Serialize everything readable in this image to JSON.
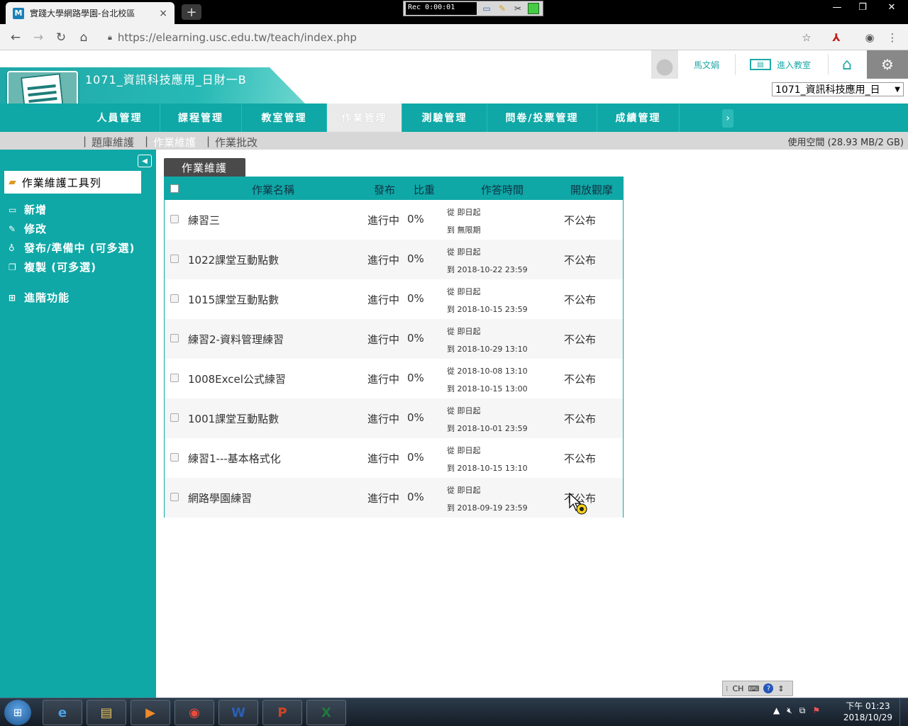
{
  "browser": {
    "tab_title": "實踐大學網路學園-台北校區",
    "tab_favicon": "M",
    "tab_close": "×",
    "new_tab": "+",
    "url": "https://elearning.usc.edu.tw/teach/index.php",
    "recorder_time": "Rec 0:00:01",
    "window_controls": [
      "—",
      "❐",
      "✕"
    ]
  },
  "header": {
    "course_title": "1071_資訊科技應用_日財一B",
    "user_name": "馬文娟",
    "enter_classroom": "進入教室",
    "course_select_value": "1071_資訊科技應用_日"
  },
  "main_nav": [
    {
      "label": "人員管理",
      "active": false
    },
    {
      "label": "課程管理",
      "active": false
    },
    {
      "label": "教室管理",
      "active": false
    },
    {
      "label": "作業管理",
      "active": true
    },
    {
      "label": "測驗管理",
      "active": false
    },
    {
      "label": "問卷/投票管理",
      "active": false
    },
    {
      "label": "成績管理",
      "active": false
    }
  ],
  "sub_nav": {
    "items": [
      {
        "label": "題庫維護",
        "active": false
      },
      {
        "label": "作業維護",
        "active": true
      },
      {
        "label": "作業批改",
        "active": false
      }
    ],
    "separator": "|",
    "usage": "使用空間 (28.93 MB/2 GB)"
  },
  "sidebar": {
    "toolbox_title": "作業維護工具列",
    "items": [
      {
        "label": "新增",
        "icon": "folder-icon"
      },
      {
        "label": "修改",
        "icon": "pencil-icon"
      },
      {
        "label": "發布/準備中 (可多選)",
        "icon": "bulb-icon"
      },
      {
        "label": "複製 (可多選)",
        "icon": "copy-icon"
      }
    ],
    "advanced": "進階功能"
  },
  "content": {
    "tab_label": "作業維護",
    "columns": [
      "作業名稱",
      "發布",
      "比重",
      "作答時間",
      "開放觀摩"
    ],
    "rows": [
      {
        "name": "練習三",
        "status": "進行中",
        "weight": "0%",
        "from": "從 即日起",
        "to": "到 無限期",
        "visibility": "不公布"
      },
      {
        "name": "1022課堂互動點數",
        "status": "進行中",
        "weight": "0%",
        "from": "從 即日起",
        "to": "到 2018-10-22 23:59",
        "visibility": "不公布"
      },
      {
        "name": "1015課堂互動點數",
        "status": "進行中",
        "weight": "0%",
        "from": "從 即日起",
        "to": "到 2018-10-15 23:59",
        "visibility": "不公布"
      },
      {
        "name": "練習2-資料管理練習",
        "status": "進行中",
        "weight": "0%",
        "from": "從 即日起",
        "to": "到 2018-10-29 13:10",
        "visibility": "不公布"
      },
      {
        "name": "1008Excel公式練習",
        "status": "進行中",
        "weight": "0%",
        "from": "從 2018-10-08 13:10",
        "to": "到 2018-10-15 13:00",
        "visibility": "不公布"
      },
      {
        "name": "1001課堂互動點數",
        "status": "進行中",
        "weight": "0%",
        "from": "從 即日起",
        "to": "到 2018-10-01 23:59",
        "visibility": "不公布"
      },
      {
        "name": "練習1---基本格式化",
        "status": "進行中",
        "weight": "0%",
        "from": "從 即日起",
        "to": "到 2018-10-15 13:10",
        "visibility": "不公布"
      },
      {
        "name": "網路學園練習",
        "status": "進行中",
        "weight": "0%",
        "from": "從 即日起",
        "to": "到 2018-09-19 23:59",
        "visibility": "不公布"
      }
    ]
  },
  "ime": {
    "label": "CH"
  },
  "taskbar": {
    "apps": [
      {
        "icon": "ie-icon",
        "glyph": "e",
        "color": "#4aa3e8"
      },
      {
        "icon": "explorer-icon",
        "glyph": "▤",
        "color": "#e8c35a"
      },
      {
        "icon": "media-player-icon",
        "glyph": "▶",
        "color": "#f08a2a"
      },
      {
        "icon": "chrome-icon",
        "glyph": "◉",
        "color": "#e94b3c"
      },
      {
        "icon": "word-icon",
        "glyph": "W",
        "color": "#2b5fb4"
      },
      {
        "icon": "powerpoint-icon",
        "glyph": "P",
        "color": "#d04525"
      },
      {
        "icon": "excel-icon",
        "glyph": "X",
        "color": "#1f7a3f"
      }
    ],
    "time": "下午 01:23",
    "date": "2018/10/29"
  }
}
